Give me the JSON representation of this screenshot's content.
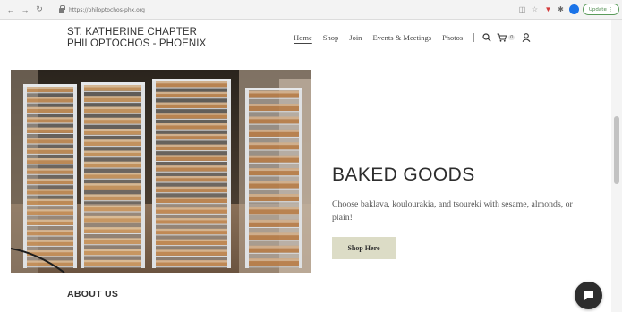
{
  "browser": {
    "url": "https://philoptochos-phx.org",
    "update_label": "Update"
  },
  "site": {
    "brand_line1": "ST. KATHERINE CHAPTER",
    "brand_line2": "PHILOPTOCHOS - PHOENIX",
    "nav": [
      "Home",
      "Shop",
      "Join",
      "Events & Meetings",
      "Photos"
    ],
    "active_nav": "Home",
    "cart_count": "0"
  },
  "hero": {
    "title": "BAKED GOODS",
    "text": "Choose baklava, koulourakia, and tsoureki with sesame, almonds, or plain!",
    "button_label": "Shop Here"
  },
  "about": {
    "heading": "ABOUT US"
  },
  "colors": {
    "button_bg": "#dcdcc6",
    "chat_bg": "#2d2d2d",
    "browser_accent": "#1a73e8"
  },
  "icons": [
    "back-icon",
    "forward-icon",
    "reload-icon",
    "lock-icon",
    "search-icon",
    "cart-icon",
    "account-icon",
    "chat-icon"
  ]
}
